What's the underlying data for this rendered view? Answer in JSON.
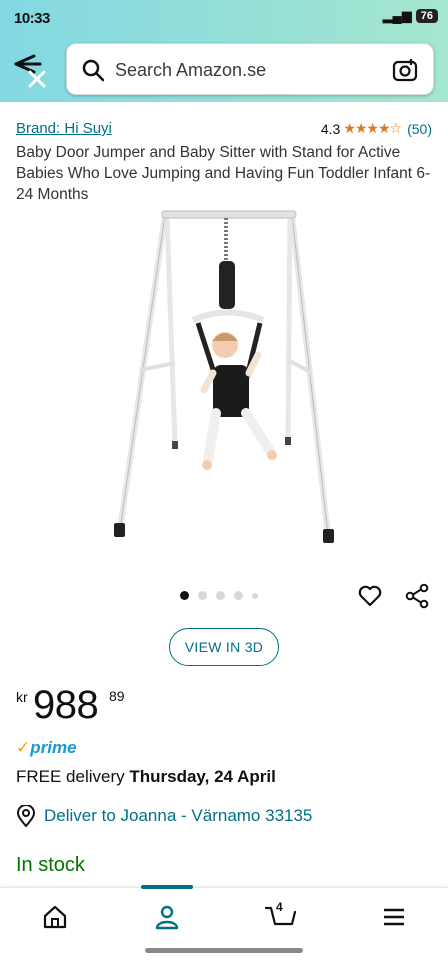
{
  "status_bar": {
    "time": "10:33",
    "battery": "76"
  },
  "search": {
    "placeholder": "Search Amazon.se"
  },
  "product": {
    "brand": "Brand: Hi Suyi",
    "rating": "4.3",
    "stars": "★★★★☆",
    "rating_count": "(50)",
    "title": "Baby Door Jumper and Baby Sitter with Stand for Active Babies Who Love Jumping and Having Fun Toddler Infant 6-24 Months",
    "image_count": 5,
    "active_image": 1
  },
  "actions": {
    "view_3d": "VIEW IN 3D"
  },
  "price": {
    "currency": "kr",
    "whole": "988",
    "fraction": "89"
  },
  "prime": {
    "check": "✓",
    "label": "prime"
  },
  "delivery": {
    "text": "FREE delivery",
    "date": "Thursday, 24 April"
  },
  "deliver_to": "Deliver to Joanna - Värnamo 33135",
  "stock": "In stock",
  "nav": {
    "cart_count": "4",
    "active": "account"
  },
  "colors": {
    "link": "#007185",
    "in_stock": "#007600",
    "star": "#de7921",
    "prime": "#1a98d5",
    "header_start": "#82d8e3",
    "header_end": "#a5e6ce"
  }
}
